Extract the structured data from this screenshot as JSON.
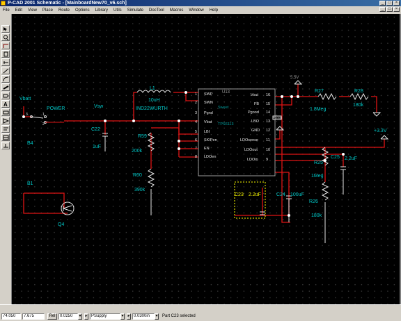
{
  "window": {
    "title": "P-CAD 2001 Schematic - [MainboardNew70_v6.sch]"
  },
  "menu": [
    "File",
    "Edit",
    "View",
    "Place",
    "Route",
    "Options",
    "Library",
    "Utils",
    "Simulate",
    "DocTool",
    "Macros",
    "Window",
    "Help"
  ],
  "toolbar": [
    "select-tool",
    "zoom-tool",
    "wire-tool",
    "part-tool",
    "pin-tool",
    "line-tool",
    "arc-tool",
    "bus-tool",
    "port-tool",
    "text-tool",
    "field-tool",
    "ieee-tool",
    "attribute-tool",
    "table-tool",
    "netlabel-tool"
  ],
  "schematic": {
    "nets": {
      "vbatt": "Vbatt",
      "power_switch": "POWER",
      "vsw": "Vsw",
      "v55": "5.5V",
      "v33": "+3.3V"
    },
    "parts": {
      "l1": {
        "ref": "L1",
        "value": "10uH",
        "part": "IND22WURTH"
      },
      "u13": {
        "ref": "U13",
        "device": "Sweet",
        "chip": "TPS6113"
      },
      "r27": {
        "ref": "R27",
        "value": "1.8Meg"
      },
      "r28": {
        "ref": "R28",
        "value": "180k"
      },
      "r59": {
        "ref": "R59",
        "value": "200k"
      },
      "r60": {
        "ref": "R60",
        "value": "390k"
      },
      "c22": {
        "ref": "C22",
        "value": "1uF"
      },
      "c23": {
        "ref": "C23",
        "value": "2.2uF"
      },
      "c24": {
        "ref": "C24",
        "value": "100uF"
      },
      "c25": {
        "ref": "C25",
        "value": "2.2uF"
      },
      "r25": {
        "ref": "R25",
        "value": "1Meg"
      },
      "r26": {
        "ref": "R26",
        "value": "180k"
      },
      "q4": {
        "ref": "Q4"
      },
      "b4": {
        "ref": "B4"
      },
      "b1": {
        "ref": "B1"
      }
    },
    "pins_left": [
      {
        "num": "1",
        "name": "SWP"
      },
      {
        "num": "2",
        "name": "SWN"
      },
      {
        "num": "3",
        "name": "Pgnd"
      },
      {
        "num": "4",
        "name": "Vbat"
      },
      {
        "num": "5",
        "name": "LBI"
      },
      {
        "num": "6",
        "name": "SKIPen"
      },
      {
        "num": "7",
        "name": "EN"
      },
      {
        "num": "8",
        "name": "LDOen"
      }
    ],
    "pins_right": [
      {
        "num": "16",
        "name": "Vout"
      },
      {
        "num": "15",
        "name": "FB"
      },
      {
        "num": "14",
        "name": "Pgood"
      },
      {
        "num": "13",
        "name": "LBO"
      },
      {
        "num": "12",
        "name": "GND"
      },
      {
        "num": "11",
        "name": "LDOsense"
      },
      {
        "num": "10",
        "name": "LDOout"
      },
      {
        "num": "9",
        "name": "LDOin"
      }
    ],
    "switch_pins": {
      "p1": "1",
      "p2": "2",
      "p3": "3"
    },
    "u13_tag": "PGOOD",
    "colors": {
      "wire": "#e01414",
      "component": "#e6e6e6",
      "label": "#00c8c8",
      "selected": "#ffff00",
      "pin": "#9c9c9c"
    }
  },
  "status": {
    "x": "74.050",
    "y": "7.675",
    "rel_label": "Rel",
    "grid": "0.0250",
    "layer": "PSupply",
    "line_width": "0.0300in",
    "message": "Part C23 selected"
  }
}
